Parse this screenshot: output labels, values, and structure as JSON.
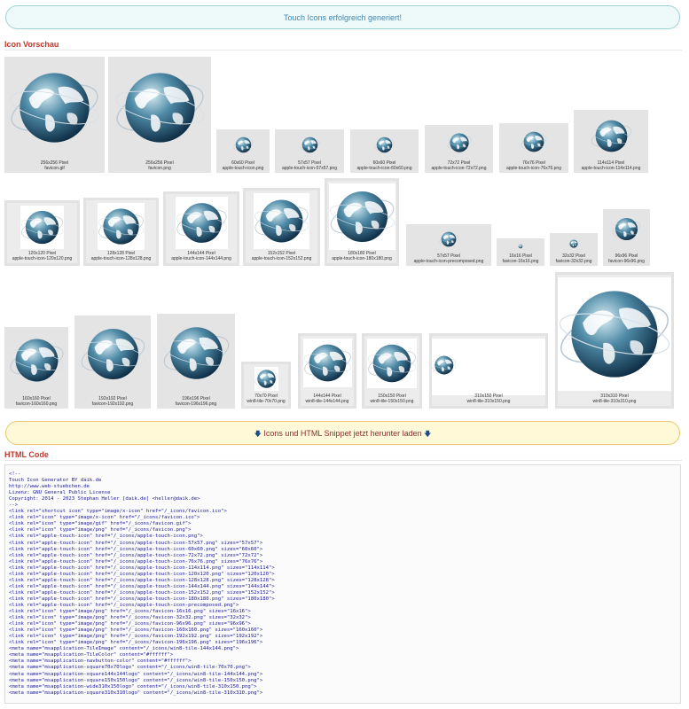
{
  "alert": {
    "text": "Touch Icons erfolgreich generiert!"
  },
  "preview": {
    "heading": "Icon Vorschau",
    "icons": [
      {
        "size": "256x256 Pixel",
        "file": "favicon.gif"
      },
      {
        "size": "256x256 Pixel",
        "file": "favicon.png"
      },
      {
        "size": "60x60 Pixel",
        "file": "apple-touch-icon.png"
      },
      {
        "size": "57x57 Pixel",
        "file": "apple-touch-icon-57x57.png"
      },
      {
        "size": "60x60 Pixel",
        "file": "apple-touch-icon-60x60.png"
      },
      {
        "size": "72x72 Pixel",
        "file": "apple-touch-icon-72x72.png"
      },
      {
        "size": "76x76 Pixel",
        "file": "apple-touch-icon-76x76.png"
      },
      {
        "size": "114x114 Pixel",
        "file": "apple-touch-icon-114x114.png"
      },
      {
        "size": "120x120 Pixel",
        "file": "apple-touch-icon-120x120.png"
      },
      {
        "size": "128x128 Pixel",
        "file": "apple-touch-icon-128x128.png"
      },
      {
        "size": "144x144 Pixel",
        "file": "apple-touch-icon-144x144.png"
      },
      {
        "size": "152x152 Pixel",
        "file": "apple-touch-icon-152x152.png"
      },
      {
        "size": "180x180 Pixel",
        "file": "apple-touch-icon-180x180.png"
      },
      {
        "size": "57x57 Pixel",
        "file": "apple-touch-icon-precomposed.png"
      },
      {
        "size": "16x16 Pixel",
        "file": "favicon-16x16.png"
      },
      {
        "size": "32x32 Pixel",
        "file": "favicon-32x32.png"
      },
      {
        "size": "96x96 Pixel",
        "file": "favicon-96x96.png"
      },
      {
        "size": "160x160 Pixel",
        "file": "favicon-160x160.png"
      },
      {
        "size": "192x192 Pixel",
        "file": "favicon-192x192.png"
      },
      {
        "size": "196x196 Pixel",
        "file": "favicon-196x196.png"
      },
      {
        "size": "70x70 Pixel",
        "file": "win8-tile-70x70.png"
      },
      {
        "size": "144x144 Pixel",
        "file": "win8-tile-144x144.png"
      },
      {
        "size": "150x150 Pixel",
        "file": "win8-tile-150x150.png"
      },
      {
        "size": "310x150 Pixel",
        "file": "win8-tile-310x150.png"
      },
      {
        "size": "310x310 Pixel",
        "file": "win8-tile-310x310.png"
      }
    ]
  },
  "download": {
    "label": "Icons und HTML Snippet jetzt herunter laden"
  },
  "html_code": {
    "heading": "HTML Code",
    "lines": [
      "<!--",
      "Touch Icon Generator BY daik.de",
      "http://www.web-stuebchen.de",
      "Lizenz: GNU General Public License",
      "Copyright: 2014 - 2023 Stephan Heller [daik.de] <heller@daik.de>",
      "-->",
      "<link rel=\"shortcut icon\" type=\"image/x-icon\" href=\"/_icons/favicon.ico\">",
      "<link rel=\"icon\" type=\"image/x-icon\" href=\"/_icons/favicon.ico\">",
      "<link rel=\"icon\" type=\"image/gif\" href=\"/_icons/favicon.gif\">",
      "<link rel=\"icon\" type=\"image/png\" href=\"/_icons/favicon.png\">",
      "<link rel=\"apple-touch-icon\" href=\"/_icons/apple-touch-icon.png\">",
      "<link rel=\"apple-touch-icon\" href=\"/_icons/apple-touch-icon-57x57.png\" sizes=\"57x57\">",
      "<link rel=\"apple-touch-icon\" href=\"/_icons/apple-touch-icon-60x60.png\" sizes=\"60x60\">",
      "<link rel=\"apple-touch-icon\" href=\"/_icons/apple-touch-icon-72x72.png\" sizes=\"72x72\">",
      "<link rel=\"apple-touch-icon\" href=\"/_icons/apple-touch-icon-76x76.png\" sizes=\"76x76\">",
      "<link rel=\"apple-touch-icon\" href=\"/_icons/apple-touch-icon-114x114.png\" sizes=\"114x114\">",
      "<link rel=\"apple-touch-icon\" href=\"/_icons/apple-touch-icon-120x120.png\" sizes=\"120x120\">",
      "<link rel=\"apple-touch-icon\" href=\"/_icons/apple-touch-icon-128x128.png\" sizes=\"128x128\">",
      "<link rel=\"apple-touch-icon\" href=\"/_icons/apple-touch-icon-144x144.png\" sizes=\"144x144\">",
      "<link rel=\"apple-touch-icon\" href=\"/_icons/apple-touch-icon-152x152.png\" sizes=\"152x152\">",
      "<link rel=\"apple-touch-icon\" href=\"/_icons/apple-touch-icon-180x180.png\" sizes=\"180x180\">",
      "<link rel=\"apple-touch-icon\" href=\"/_icons/apple-touch-icon-precomposed.png\">",
      "<link rel=\"icon\" type=\"image/png\" href=\"/_icons/favicon-16x16.png\" sizes=\"16x16\">",
      "<link rel=\"icon\" type=\"image/png\" href=\"/_icons/favicon-32x32.png\" sizes=\"32x32\">",
      "<link rel=\"icon\" type=\"image/png\" href=\"/_icons/favicon-96x96.png\" sizes=\"96x96\">",
      "<link rel=\"icon\" type=\"image/png\" href=\"/_icons/favicon-160x160.png\" sizes=\"160x160\">",
      "<link rel=\"icon\" type=\"image/png\" href=\"/_icons/favicon-192x192.png\" sizes=\"192x192\">",
      "<link rel=\"icon\" type=\"image/png\" href=\"/_icons/favicon-196x196.png\" sizes=\"196x196\">",
      "<meta name=\"msapplication-TileImage\" content=\"/_icons/win8-tile-144x144.png\">",
      "<meta name=\"msapplication-TileColor\" content=\"#ffffff\">",
      "<meta name=\"msapplication-navbutton-color\" content=\"#ffffff\">",
      "<meta name=\"msapplication-square70x70logo\" content=\"/_icons/win8-tile-70x70.png\">",
      "<meta name=\"msapplication-square144x144logo\" content=\"/_icons/win8-tile-144x144.png\">",
      "<meta name=\"msapplication-square150x150logo\" content=\"/_icons/win8-tile-150x150.png\">",
      "<meta name=\"msapplication-wide310x150logo\" content=\"/_icons/win8-tile-310x150.png\">",
      "<meta name=\"msapplication-square310x310logo\" content=\"/_icons/win8-tile-310x310.png\">"
    ]
  },
  "colors": {
    "heading": "#c0392b",
    "alert_text": "#3f86b5",
    "alert_bg": "#eefaf9",
    "download_bg": "#fff9d7",
    "code_text": "#1a1a9a"
  },
  "globe_icon": "globe-icon"
}
